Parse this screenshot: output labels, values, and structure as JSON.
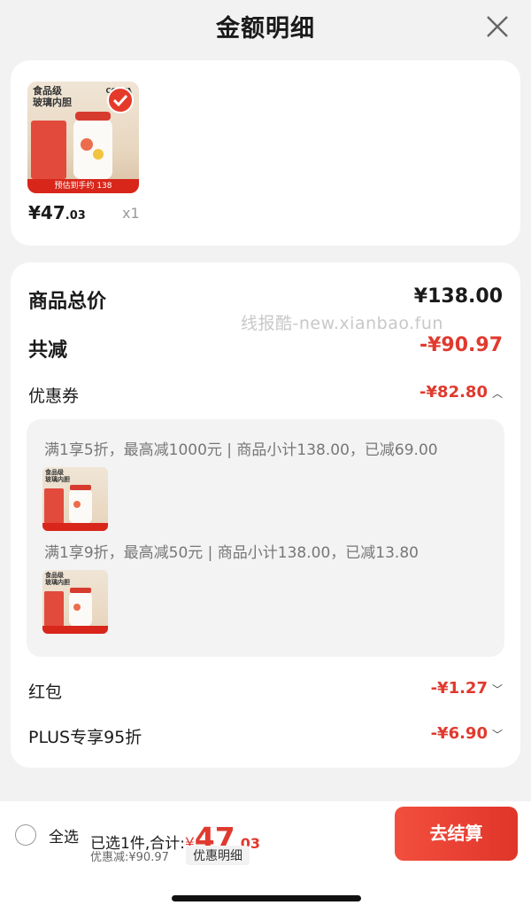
{
  "header": {
    "title": "金额明细"
  },
  "product": {
    "image_text": "食品级\n玻璃内胆",
    "image_brand": "COSTA",
    "image_banner": "预估到手约 138",
    "price_int": "¥47",
    "price_dec": ".03",
    "qty": "x1"
  },
  "breakdown": {
    "watermark": "线报酷-new.xianbao.fun",
    "total_label": "商品总价",
    "total_value": "¥138.00",
    "reduce_label": "共减",
    "reduce_value": "-¥90.97",
    "coupon_label": "优惠券",
    "coupon_value": "-¥82.80",
    "coupons": [
      {
        "text": "满1享5折，最高减1000元 | 商品小计138.00，已减69.00"
      },
      {
        "text": "满1享9折，最高减50元 | 商品小计138.00，已减13.80"
      }
    ],
    "redpacket_label": "红包",
    "redpacket_value": "-¥1.27",
    "plus_label": "PLUS专享95折",
    "plus_value": "-¥6.90"
  },
  "footer": {
    "select_all": "全选",
    "summary_prefix": "已选1件,合计:",
    "total_symbol": "¥",
    "total_int": "47",
    "total_dec": ".03",
    "discount": "优惠减:¥90.97",
    "detail_btn": "优惠明细",
    "checkout": "去结算"
  },
  "colors": {
    "accent": "#e03a2e",
    "checkout_bg": "#e8402f"
  }
}
